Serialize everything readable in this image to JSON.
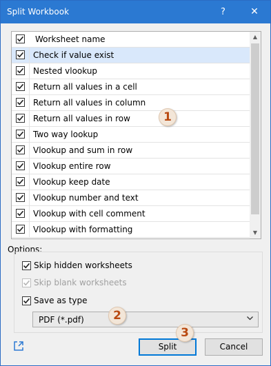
{
  "window": {
    "title": "Split Workbook",
    "help_label": "?",
    "close_label": "✕"
  },
  "list": {
    "header": "Worksheet name",
    "items": [
      {
        "label": "Check if value exist",
        "checked": true,
        "selected": true
      },
      {
        "label": "Nested vlookup",
        "checked": true
      },
      {
        "label": "Return all values in a cell",
        "checked": true
      },
      {
        "label": "Return all values in column",
        "checked": true
      },
      {
        "label": "Return all values in row",
        "checked": true
      },
      {
        "label": "Two way lookup",
        "checked": true
      },
      {
        "label": "Vlookup and sum in row",
        "checked": true
      },
      {
        "label": "Vlookup entire row",
        "checked": true
      },
      {
        "label": "Vlookup keep date",
        "checked": true
      },
      {
        "label": "Vlookup number and text",
        "checked": true
      },
      {
        "label": "Vlookup with cell comment",
        "checked": true
      },
      {
        "label": "Vlookup with formatting",
        "checked": true
      }
    ]
  },
  "badges": [
    "1",
    "2",
    "3"
  ],
  "options": {
    "group_label": "Options:",
    "skip_hidden": {
      "label": "Skip hidden worksheets",
      "checked": true,
      "enabled": true
    },
    "skip_blank": {
      "label": "Skip blank worksheets",
      "checked": true,
      "enabled": false
    },
    "save_as_type": {
      "label": "Save as type",
      "checked": true,
      "enabled": true
    },
    "file_type": "PDF (*.pdf)"
  },
  "buttons": {
    "split": "Split",
    "cancel": "Cancel"
  },
  "colors": {
    "titlebar": "#2b79d2",
    "selection": "#d9e8fb",
    "badge_text": "#b94a12",
    "primary_border": "#0078d7"
  }
}
